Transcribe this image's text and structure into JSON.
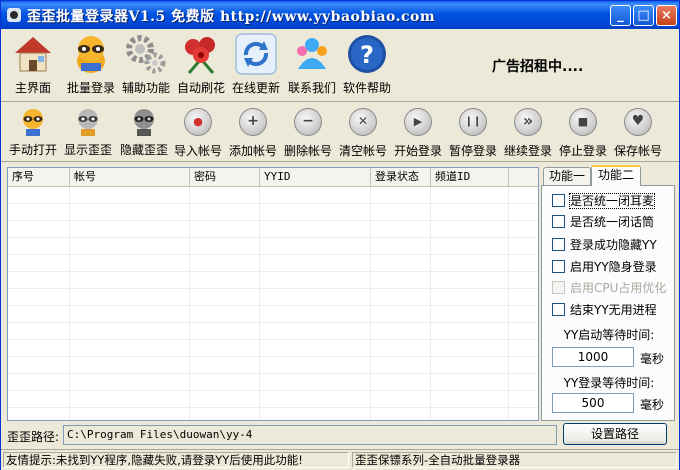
{
  "window": {
    "title": "歪歪批量登录器V1.5 免费版 http://www.yybaobiao.com",
    "minimize": "_",
    "maximize": "□",
    "close": "×"
  },
  "toolbar_main": [
    {
      "label": "主界面",
      "icon": "house-icon"
    },
    {
      "label": "批量登录",
      "icon": "raccoon-icon"
    },
    {
      "label": "辅助功能",
      "icon": "gears-icon"
    },
    {
      "label": "自动刷花",
      "icon": "roses-icon"
    },
    {
      "label": "在线更新",
      "icon": "refresh-icon"
    },
    {
      "label": "联系我们",
      "icon": "people-icon"
    },
    {
      "label": "软件帮助",
      "icon": "help-icon"
    }
  ],
  "ad_text": "广告招租中....",
  "toolbar_actions": [
    {
      "label": "手动打开",
      "icon": "raccoon-icon"
    },
    {
      "label": "显示歪歪",
      "icon": "raccoon-gray-icon"
    },
    {
      "label": "隐藏歪歪",
      "icon": "raccoon-dark-icon"
    },
    {
      "label": "导入帐号",
      "icon": "record-icon",
      "glyph": "●"
    },
    {
      "label": "添加帐号",
      "icon": "plus-icon",
      "glyph": "+"
    },
    {
      "label": "删除帐号",
      "icon": "minus-icon",
      "glyph": "−"
    },
    {
      "label": "清空帐号",
      "icon": "x-icon",
      "glyph": "✕"
    },
    {
      "label": "开始登录",
      "icon": "play-icon",
      "glyph": "▶"
    },
    {
      "label": "暂停登录",
      "icon": "pause-icon",
      "glyph": "❙❙"
    },
    {
      "label": "继续登录",
      "icon": "forward-icon",
      "glyph": "»"
    },
    {
      "label": "停止登录",
      "icon": "stop-icon",
      "glyph": "■"
    },
    {
      "label": "保存帐号",
      "icon": "heart-icon",
      "glyph": "♥"
    }
  ],
  "table": {
    "columns": [
      "序号",
      "帐号",
      "密码",
      "YYID",
      "登录状态",
      "频道ID"
    ],
    "rows": []
  },
  "panel": {
    "tabs": [
      "功能一",
      "功能二"
    ],
    "active_tab": 1,
    "options": [
      {
        "label": "是否统一闭耳麦",
        "checked": false,
        "enabled": true,
        "focused": true
      },
      {
        "label": "是否统一闭话筒",
        "checked": false,
        "enabled": true
      },
      {
        "label": "登录成功隐藏YY",
        "checked": false,
        "enabled": true
      },
      {
        "label": "启用YY隐身登录",
        "checked": false,
        "enabled": true
      },
      {
        "label": "启用CPU占用优化",
        "checked": false,
        "enabled": false
      },
      {
        "label": "结束YY无用进程",
        "checked": false,
        "enabled": true
      }
    ],
    "start_wait_label": "YY启动等待时间:",
    "start_wait_value": "1000",
    "login_wait_label": "YY登录等待时间:",
    "login_wait_value": "500",
    "unit": "毫秒"
  },
  "path": {
    "label": "歪歪路径:",
    "value": "C:\\Program Files\\duowan\\yy-4",
    "button": "设置路径"
  },
  "status": {
    "left": "友情提示:未找到YY程序,隐藏失败,请登录YY后使用此功能!",
    "right": "歪歪保镖系列-全自动批量登录器"
  }
}
